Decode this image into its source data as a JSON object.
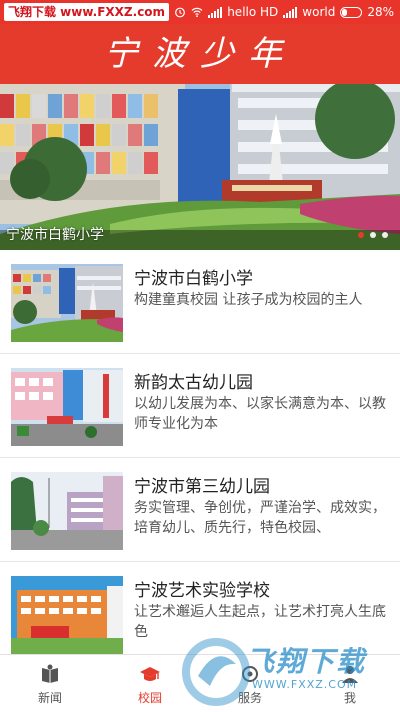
{
  "status_bar": {
    "watermark": "飞翔下载 www.FXXZ.com",
    "carrier1": "hello HD",
    "carrier2": "world",
    "battery": "28%",
    "battery_level": 0.28
  },
  "header": {
    "title": "宁波少年"
  },
  "banner": {
    "caption": "宁波市白鹤小学",
    "dot_count": 3,
    "active_dot": 0
  },
  "list": [
    {
      "title": "宁波市白鹤小学",
      "desc": "构建童真校园 让孩子成为校园的主人"
    },
    {
      "title": "新韵太古幼儿园",
      "desc": "以幼儿发展为本、以家长满意为本、以教师专业化为本"
    },
    {
      "title": "宁波市第三幼儿园",
      "desc": "务实管理、争创优，严谨治学、成效实，培育幼儿、质先行，特色校园、"
    },
    {
      "title": "宁波艺术实验学校",
      "desc": "让艺术邂逅人生起点，让艺术打亮人生底色"
    }
  ],
  "tabs": [
    {
      "label": "新闻",
      "icon": "book-icon",
      "active": false
    },
    {
      "label": "校园",
      "icon": "graduation-cap-icon",
      "active": true
    },
    {
      "label": "服务",
      "icon": "service-icon",
      "active": false
    },
    {
      "label": "我",
      "icon": "person-icon",
      "active": false
    }
  ],
  "watermark": {
    "brand": "飞翔下载",
    "url": "WWW.FXXZ.COM"
  },
  "colors": {
    "accent": "#e43b2c",
    "status_bar": "#e8342a",
    "watermark_blue": "#288cc8"
  }
}
